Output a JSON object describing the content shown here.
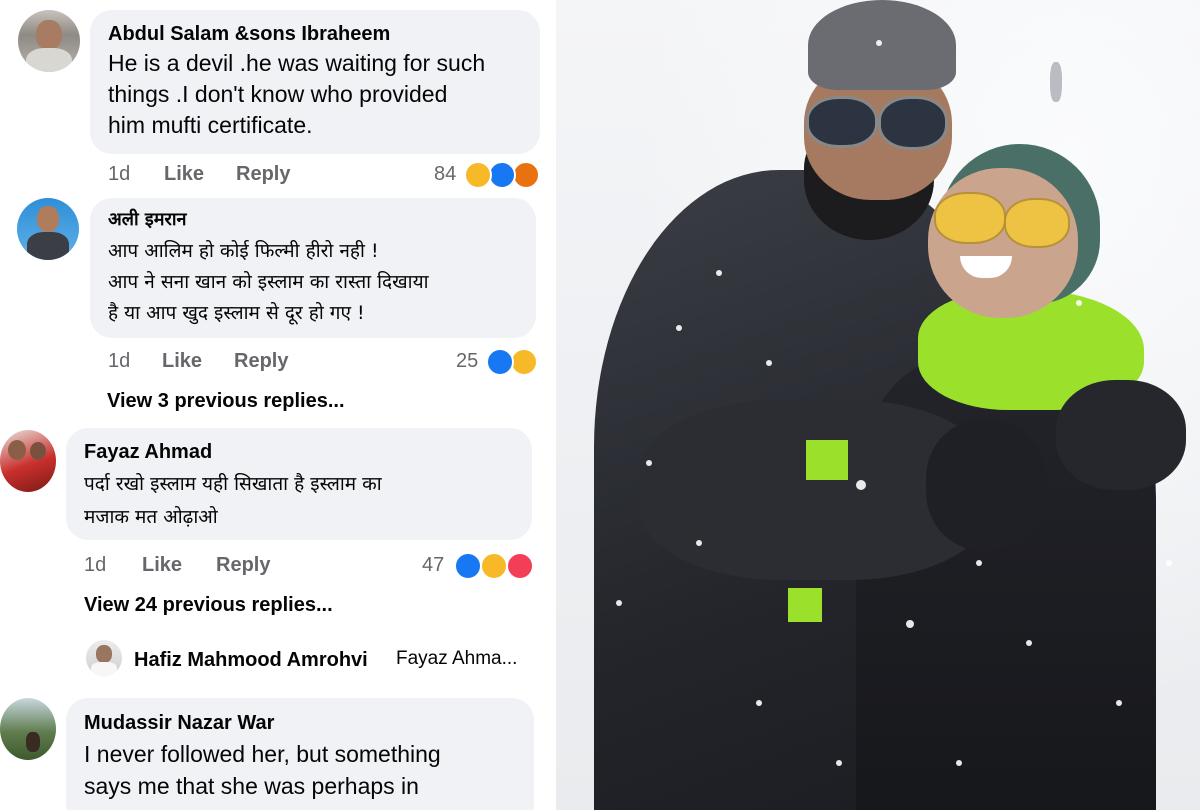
{
  "comments": [
    {
      "author": "Abdul Salam &sons Ibraheem",
      "lines": [
        "He is a devil .he was waiting for such",
        "things .I don't know who provided",
        "him mufti certificate."
      ],
      "time": "1d",
      "like": "Like",
      "reply": "Reply",
      "reaction_count": "84",
      "reactions": [
        "haha",
        "like",
        "angry"
      ]
    },
    {
      "author": "अली इमरान",
      "lines": [
        "आप आलिम हो कोई फिल्मी हीरो नही !",
        "आप ने सना खान को इस्लाम का रास्ता दिखाया",
        "है या आप खुद इस्लाम से दूर हो गए !"
      ],
      "time": "1d",
      "like": "Like",
      "reply": "Reply",
      "reaction_count": "25",
      "reactions": [
        "like",
        "haha"
      ],
      "view_replies": "View 3 previous replies..."
    },
    {
      "author": "Fayaz Ahmad",
      "lines": [
        "पर्दा रखो इस्लाम यही सिखाता है इस्लाम का",
        "मजाक मत ओढ़ाओ"
      ],
      "time": "1d",
      "like": "Like",
      "reply": "Reply",
      "reaction_count": "47",
      "reactions": [
        "like",
        "haha",
        "love"
      ],
      "view_replies": "View 24 previous replies...",
      "reply_preview": {
        "author": "Hafiz Mahmood Amrohvi",
        "text": "Fayaz Ahma..."
      }
    },
    {
      "author": "Mudassir Nazar War",
      "lines": [
        "I never followed her, but something",
        "says me that she was perhaps in"
      ]
    }
  ],
  "colors": {
    "bubble": "#f0f2f5",
    "meta": "#65676b",
    "like_blue": "#1877f2",
    "haha_yellow": "#f7b928",
    "angry_orange": "#e9710f",
    "love_red": "#f33e58"
  }
}
